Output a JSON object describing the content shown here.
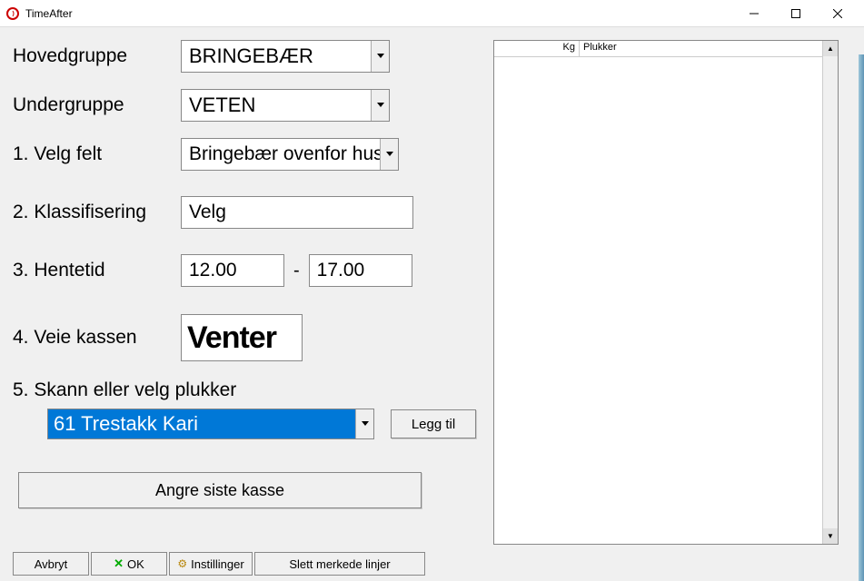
{
  "window": {
    "title": "TimeAfter"
  },
  "labels": {
    "hovedgruppe": "Hovedgruppe",
    "undergruppe": "Undergruppe",
    "velg_felt": "1. Velg felt",
    "klassifisering": "2. Klassifisering",
    "hentetid": "3. Hentetid",
    "veie_kassen": "4. Veie kassen",
    "skann_velg": "5. Skann eller velg plukker"
  },
  "values": {
    "hovedgruppe": "BRINGEBÆR",
    "undergruppe": "VETEN",
    "felt": "Bringebær ovenfor hus",
    "klassifisering": "Velg",
    "hentetid_fra": "12.00",
    "hentetid_til": "17.00",
    "hentetid_dash": "-",
    "veie": "Venter",
    "plukker": "61 Trestakk Kari"
  },
  "buttons": {
    "legg_til": "Legg til",
    "angre": "Angre siste kasse",
    "avbryt": "Avbryt",
    "ok": "OK",
    "innstillinger": "Instillinger",
    "slett": "Slett merkede linjer"
  },
  "list": {
    "col_kg": "Kg",
    "col_plukker": "Plukker"
  },
  "icons": {
    "x": "✕",
    "gear": "⚙"
  }
}
